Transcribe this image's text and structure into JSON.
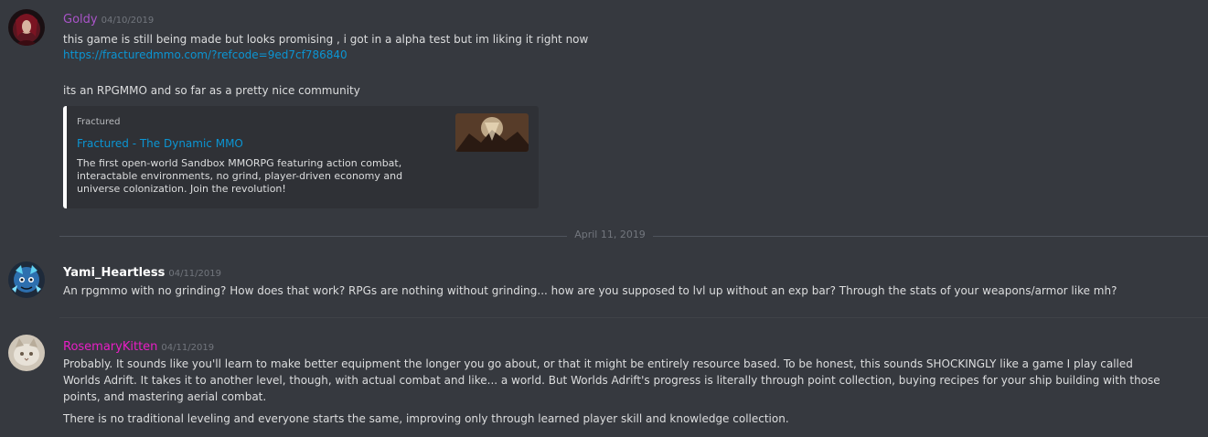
{
  "messages": [
    {
      "username": "Goldy",
      "username_color": "#a954c8",
      "timestamp": "04/10/2019",
      "lines": [
        "this game is still being made but looks promising , i got in a alpha test but im liking it right now",
        "https://fracturedmmo.com/?refcode=9ed7cf786840",
        "its an RPGMMO and so far as a pretty nice community"
      ],
      "embed": {
        "provider": "Fractured",
        "title": "Fractured - The Dynamic MMO",
        "description": "The first open-world Sandbox MMORPG featuring action combat, interactable environments, no grind, player-driven economy and universe colonization. Join the revolution!",
        "thumbnail_icon": "game-art-thumbnail",
        "border_color": "#ffffff"
      }
    },
    {
      "username": "Yami_Heartless",
      "username_color": "#ffffff",
      "timestamp": "04/11/2019",
      "lines": [
        "An rpgmmo with no grinding? How does that work? RPGs are nothing without grinding... how are you supposed to lvl up without an exp bar? Through the stats of your weapons/armor like mh?"
      ]
    },
    {
      "username": "RosemaryKitten",
      "username_color": "#e91ec6",
      "timestamp": "04/11/2019",
      "lines": [
        "Probably. It sounds like you'll learn to make better equipment the longer you go about, or that it might be entirely resource based. To be honest, this sounds SHOCKINGLY like a game I play called",
        "Worlds Adrift. It takes it to another level, though, with actual combat and like... a world. But Worlds Adrift's progress is literally through point collection, buying recipes for your ship building with those",
        "points, and mastering aerial combat.",
        "There is no traditional leveling and everyone starts the same, improving only through learned player skill and knowledge collection."
      ]
    }
  ],
  "date_divider": "April 11, 2019",
  "colors": {
    "background": "#36393f",
    "link": "#0b95d3",
    "muted": "#72767d",
    "text": "#dcddde"
  }
}
